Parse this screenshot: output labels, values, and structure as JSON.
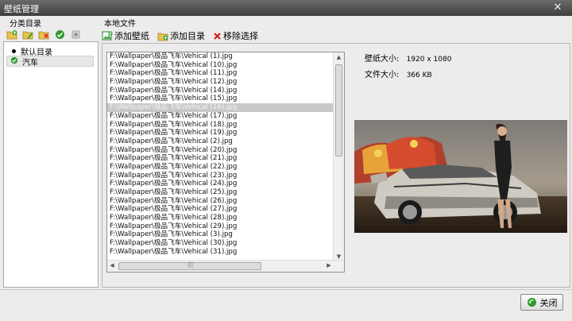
{
  "window": {
    "title": "壁纸管理"
  },
  "left": {
    "header": "分类目录",
    "toolbar_icons": [
      "add-folder-icon",
      "edit-folder-icon",
      "delete-folder-icon",
      "check-icon",
      "settings-icon"
    ],
    "categories": [
      {
        "label": "默认目录",
        "selected": false
      },
      {
        "label": "汽车",
        "selected": true
      }
    ]
  },
  "right": {
    "header": "本地文件",
    "toolbar": {
      "add_wallpaper": "添加壁纸",
      "add_directory": "添加目录",
      "remove_selection": "移除选择"
    },
    "files": [
      "F:\\Wallpaper\\极品飞车\\Vehical (1).jpg",
      "F:\\Wallpaper\\极品飞车\\Vehical (10).jpg",
      "F:\\Wallpaper\\极品飞车\\Vehical (11).jpg",
      "F:\\Wallpaper\\极品飞车\\Vehical (12).jpg",
      "F:\\Wallpaper\\极品飞车\\Vehical (14).jpg",
      "F:\\Wallpaper\\极品飞车\\Vehical (15).jpg",
      "F:\\Wallpaper\\极品飞车\\Vehical (16).jpg",
      "F:\\Wallpaper\\极品飞车\\Vehical (17).jpg",
      "F:\\Wallpaper\\极品飞车\\Vehical (18).jpg",
      "F:\\Wallpaper\\极品飞车\\Vehical (19).jpg",
      "F:\\Wallpaper\\极品飞车\\Vehical (2).jpg",
      "F:\\Wallpaper\\极品飞车\\Vehical (20).jpg",
      "F:\\Wallpaper\\极品飞车\\Vehical (21).jpg",
      "F:\\Wallpaper\\极品飞车\\Vehical (22).jpg",
      "F:\\Wallpaper\\极品飞车\\Vehical (23).jpg",
      "F:\\Wallpaper\\极品飞车\\Vehical (24).jpg",
      "F:\\Wallpaper\\极品飞车\\Vehical (25).jpg",
      "F:\\Wallpaper\\极品飞车\\Vehical (26).jpg",
      "F:\\Wallpaper\\极品飞车\\Vehical (27).jpg",
      "F:\\Wallpaper\\极品飞车\\Vehical (28).jpg",
      "F:\\Wallpaper\\极品飞车\\Vehical (29).jpg",
      "F:\\Wallpaper\\极品飞车\\Vehical (3).jpg",
      "F:\\Wallpaper\\极品飞车\\Vehical (30).jpg",
      "F:\\Wallpaper\\极品飞车\\Vehical (31).jpg"
    ],
    "selected_file_index": 6,
    "info": {
      "size_label": "壁纸大小:",
      "size_value": "1920 x 1080",
      "filesize_label": "文件大小:",
      "filesize_value": "366 KB"
    }
  },
  "footer": {
    "close_label": "关闭"
  }
}
